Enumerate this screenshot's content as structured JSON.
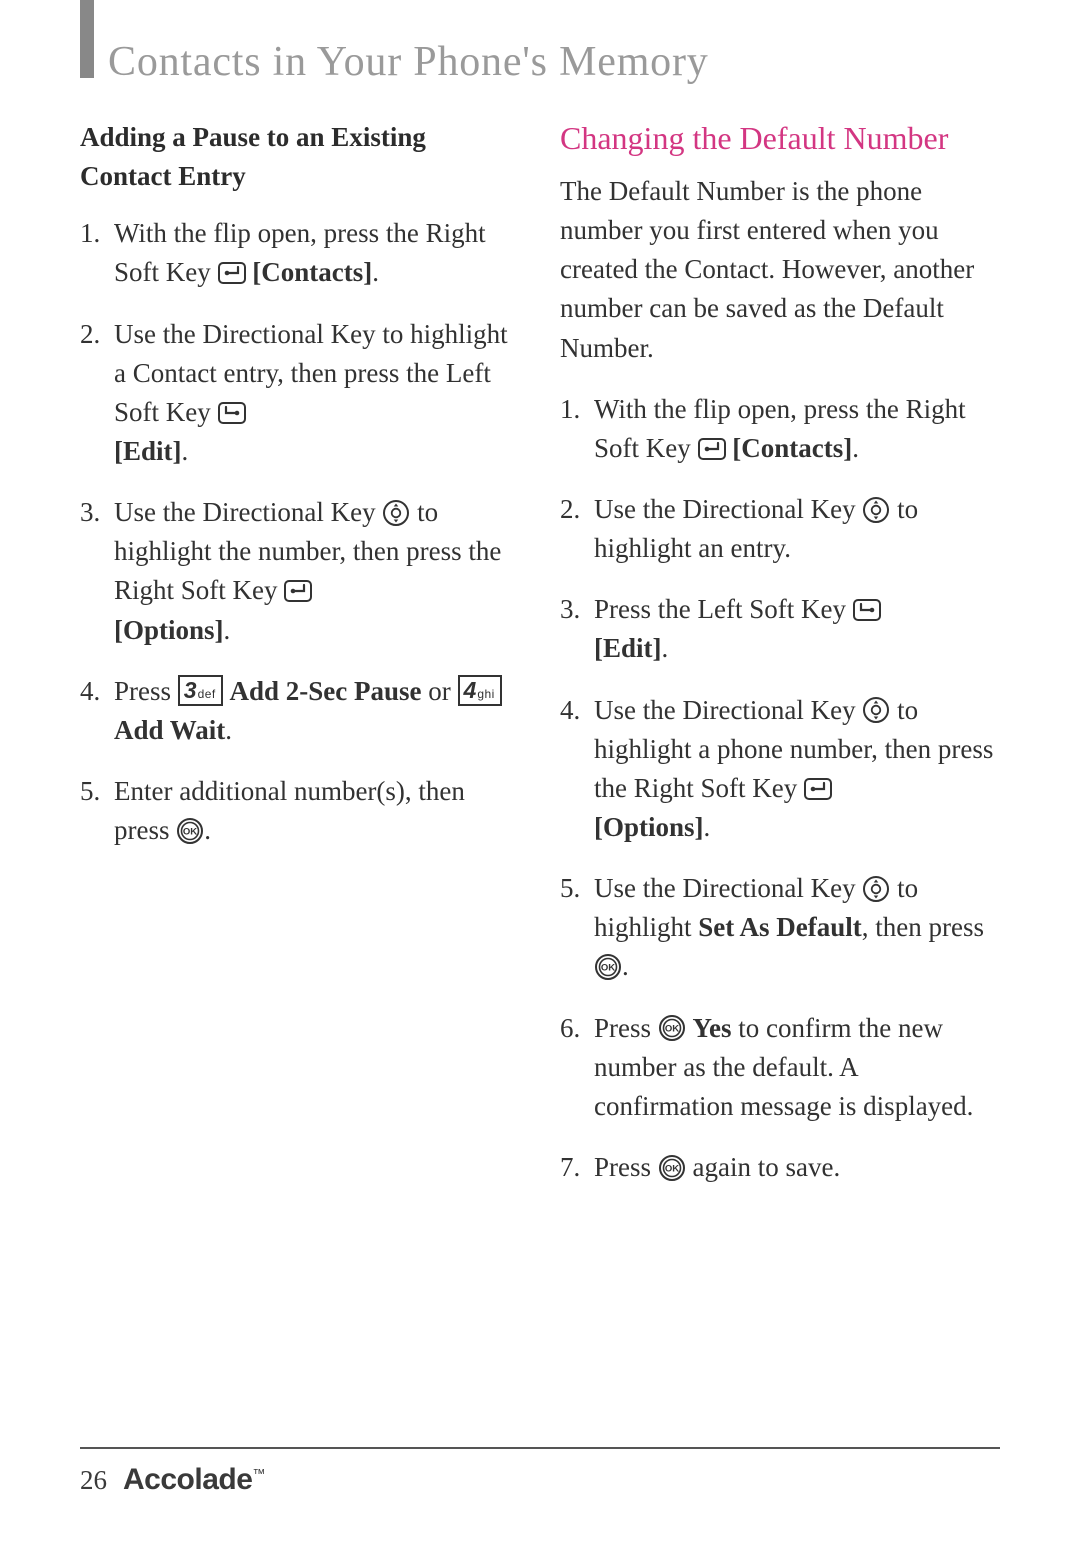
{
  "header": {
    "title": "Contacts in Your Phone's Memory"
  },
  "left": {
    "subhead": "Adding a Pause to an Existing Contact Entry",
    "steps": [
      {
        "num": "1.",
        "pre": "With the flip open, press the Right Soft Key ",
        "icon": "right-soft-key",
        "post_bold": "[Contacts]",
        "post": "."
      },
      {
        "num": "2.",
        "pre": "Use the Directional Key to highlight a Contact entry, then press the Left Soft Key ",
        "icon": "left-soft-key",
        "break": true,
        "post_bold": "[Edit]",
        "post": "."
      },
      {
        "num": "3.",
        "pre": "Use the Directional Key ",
        "icon": "dir-key",
        "mid": " to highlight the number, then press the Right Soft Key ",
        "icon2": "right-soft-key",
        "break2": true,
        "post_bold": "[Options]",
        "post": "."
      },
      {
        "num": "4.",
        "pre": "Press ",
        "key3": {
          "big": "3",
          "small": "def"
        },
        "mid_bold": " Add 2-Sec Pause",
        "mid2": " or ",
        "key4": {
          "big": "4",
          "small": "ghi"
        },
        "post_bold2": " Add Wait",
        "post": "."
      },
      {
        "num": "5.",
        "pre": "Enter additional number(s), then press ",
        "icon": "ok-key",
        "post": "."
      }
    ]
  },
  "right": {
    "title": "Changing the Default Number",
    "intro": "The Default Number is the phone number you first entered when you created the Contact. However, another number can be saved as the Default Number.",
    "steps": [
      {
        "num": "1.",
        "pre": "With the flip open, press the Right Soft Key ",
        "icon": "right-soft-key",
        "post_bold": "[Contacts]",
        "post": "."
      },
      {
        "num": "2.",
        "pre": "Use the Directional Key ",
        "icon": "dir-key",
        "post": " to highlight an entry."
      },
      {
        "num": "3.",
        "pre": "Press the Left Soft Key ",
        "icon": "left-soft-key",
        "break": true,
        "post_bold": "[Edit]",
        "post": "."
      },
      {
        "num": "4.",
        "pre": "Use the Directional Key ",
        "icon": "dir-key",
        "mid": " to highlight a phone number, then press the Right Soft Key ",
        "icon2": "right-soft-key",
        "break2": true,
        "post_bold": "[Options]",
        "post": "."
      },
      {
        "num": "5.",
        "pre": "Use the Directional Key ",
        "icon": "dir-key",
        "mid": " to highlight ",
        "mid_bold": "Set As Default",
        "mid2": ", then press ",
        "icon2": "ok-key",
        "post": "."
      },
      {
        "num": "6.",
        "pre": "Press ",
        "icon": "ok-key",
        "mid_bold": " Yes",
        "post": " to confirm the new number as the default. A confirmation message is displayed."
      },
      {
        "num": "7.",
        "pre": "Press ",
        "icon": "ok-key",
        "post": " again to save."
      }
    ]
  },
  "footer": {
    "page": "26",
    "brand": "Accolade",
    "tm": "™"
  }
}
